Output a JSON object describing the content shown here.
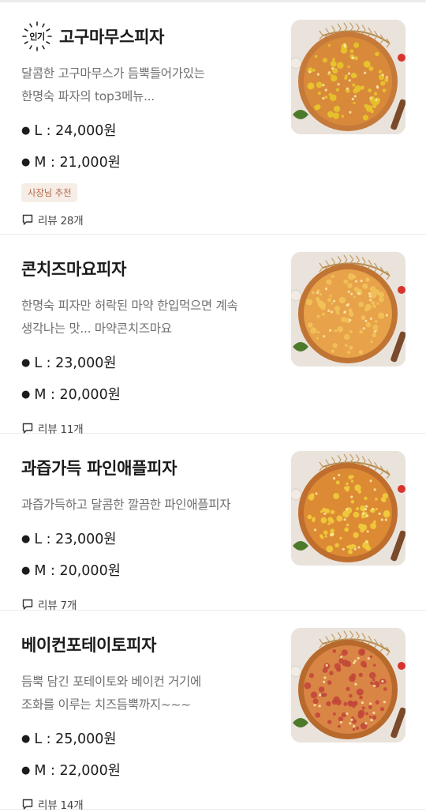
{
  "menu": [
    {
      "title": "고구마무스피자",
      "badge": "인기",
      "desc_lines": [
        "달콤한 고구마무스가 듬뿍들어가있는",
        "한명숙 파자의 top3메뉴..."
      ],
      "prices": [
        "L : 24,000원",
        "M : 21,000원"
      ],
      "tag": "사장님 추천",
      "review": "리뷰 28개",
      "pizza": {
        "crust": "#c67a3a",
        "sauce": "#d88a3a",
        "topping": "#e8c42c"
      }
    },
    {
      "title": "콘치즈마요피자",
      "desc_lines": [
        "한명숙 피자만 허락된 마약 한입먹으면 계속",
        "생각나는 맛... 마약콘치즈마요"
      ],
      "prices": [
        "L : 23,000원",
        "M : 20,000원"
      ],
      "review": "리뷰 11개",
      "pizza": {
        "crust": "#c07534",
        "sauce": "#e7a24a",
        "topping": "#f2c25a"
      }
    },
    {
      "title": "과즙가득 파인애플피자",
      "desc_lines": [
        "과즙가득하고 달콤한 깔끔한 파인애플피자"
      ],
      "prices": [
        "L : 23,000원",
        "M : 20,000원"
      ],
      "review": "리뷰 7개",
      "pizza": {
        "crust": "#bf6e2e",
        "sauce": "#dc8a34",
        "topping": "#f0cb3c"
      }
    },
    {
      "title": "베이컨포테이토피자",
      "desc_lines": [
        "듬뿍 담긴 포테이토와 베이컨 거기에",
        "조화를 이루는 치즈듬뿍까지~~~"
      ],
      "prices": [
        "L : 25,000원",
        "M : 22,000원"
      ],
      "review": "리뷰 14개",
      "pizza": {
        "crust": "#b8692c",
        "sauce": "#d98546",
        "topping": "#c2473a"
      }
    }
  ]
}
